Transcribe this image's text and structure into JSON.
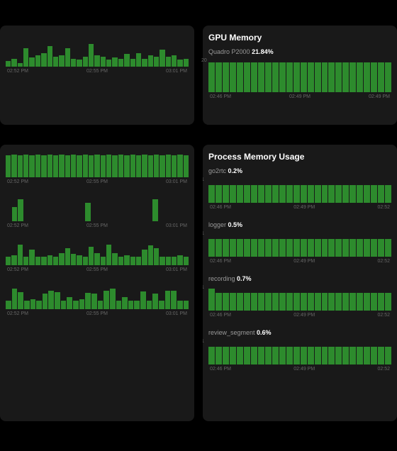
{
  "row1": {
    "left_panel": {
      "x_ticks": [
        "02:52 PM",
        "02:55 PM",
        "03:01 PM"
      ]
    },
    "gpu_memory": {
      "title": "GPU Memory",
      "device": "Quadro P2000",
      "value": "21.84%",
      "y_tick": "20",
      "x_ticks": [
        "02:46 PM",
        "02:49 PM",
        "02:49 PM"
      ]
    }
  },
  "row2": {
    "left_stack": {
      "x_ticks": [
        "02:52 PM",
        "02:55 PM",
        "03:01 PM"
      ]
    },
    "process_memory": {
      "title": "Process Memory Usage",
      "x_ticks": [
        "02:46 PM",
        "02:49 PM",
        "02:52"
      ],
      "y_tick": "1",
      "items": [
        {
          "name": "go2rtc",
          "value": "0.2%"
        },
        {
          "name": "logger",
          "value": "0.5%"
        },
        {
          "name": "recording",
          "value": "0.7%"
        },
        {
          "name": "review_segment",
          "value": "0.6%"
        }
      ]
    }
  },
  "chart_data": [
    {
      "type": "bar",
      "title": "",
      "xlabel": "",
      "ylabel": "",
      "x_ticks": [
        "02:52 PM",
        "02:55 PM",
        "03:01 PM"
      ],
      "values": [
        5,
        7,
        3,
        16,
        8,
        10,
        12,
        18,
        9,
        10,
        16,
        7,
        6,
        9,
        20,
        10,
        9,
        6,
        8,
        7,
        11,
        7,
        12,
        7,
        10,
        9,
        15,
        9,
        10,
        6,
        7
      ]
    },
    {
      "type": "bar",
      "title": "GPU Memory",
      "series_name": "Quadro P2000",
      "current": 21.84,
      "xlabel": "",
      "ylabel": "%",
      "ylim": [
        0,
        25
      ],
      "x_ticks": [
        "02:46 PM",
        "02:49 PM",
        "02:49 PM"
      ],
      "values": [
        22,
        22,
        22,
        22,
        22,
        22,
        22,
        22,
        22,
        22,
        22,
        22,
        22,
        22,
        22,
        22,
        22,
        22,
        22,
        22,
        22,
        22,
        22,
        22,
        22,
        22
      ]
    },
    {
      "type": "bar",
      "title": "left-stack-0",
      "x_ticks": [
        "02:52 PM",
        "02:55 PM",
        "03:01 PM"
      ],
      "values": [
        26,
        27,
        26,
        27,
        26,
        27,
        26,
        27,
        26,
        27,
        26,
        27,
        26,
        27,
        26,
        27,
        26,
        27,
        26,
        27,
        26,
        27,
        26,
        27,
        26,
        27,
        26,
        27,
        26,
        27,
        26
      ]
    },
    {
      "type": "bar",
      "title": "left-stack-1",
      "x_ticks": [
        "02:52 PM",
        "02:55 PM",
        "03:01 PM"
      ],
      "values": [
        0,
        17,
        26,
        0,
        0,
        0,
        0,
        0,
        0,
        0,
        0,
        0,
        0,
        22,
        0,
        0,
        0,
        0,
        0,
        0,
        0,
        0,
        0,
        0,
        26,
        0,
        0,
        0,
        0,
        0
      ]
    },
    {
      "type": "bar",
      "title": "left-stack-2",
      "x_ticks": [
        "02:52 PM",
        "02:55 PM",
        "03:01 PM"
      ],
      "values": [
        10,
        12,
        24,
        10,
        18,
        10,
        10,
        12,
        10,
        14,
        20,
        13,
        12,
        10,
        22,
        14,
        10,
        24,
        14,
        10,
        12,
        10,
        10,
        18,
        23,
        20,
        10,
        10,
        10,
        12,
        10
      ]
    },
    {
      "type": "bar",
      "title": "left-stack-3",
      "x_ticks": [
        "02:52 PM",
        "02:55 PM",
        "03:01 PM"
      ],
      "values": [
        10,
        24,
        20,
        10,
        12,
        10,
        18,
        22,
        20,
        10,
        14,
        10,
        12,
        19,
        18,
        10,
        22,
        24,
        10,
        14,
        10,
        10,
        21,
        10,
        18,
        10,
        22,
        22,
        10,
        10
      ]
    },
    {
      "type": "bar",
      "title": "Process Memory Usage",
      "xlabel": "",
      "ylabel": "%",
      "ylim": [
        0,
        1
      ],
      "x_ticks": [
        "02:46 PM",
        "02:49 PM",
        "02:52"
      ],
      "series": [
        {
          "name": "go2rtc",
          "current": 0.2,
          "values": [
            0.7,
            0.7,
            0.7,
            0.7,
            0.7,
            0.7,
            0.7,
            0.7,
            0.7,
            0.7,
            0.7,
            0.7,
            0.7,
            0.7,
            0.7,
            0.7,
            0.7,
            0.7,
            0.7,
            0.7,
            0.7,
            0.7,
            0.7,
            0.7,
            0.7,
            0.7
          ]
        },
        {
          "name": "logger",
          "current": 0.5,
          "values": [
            0.7,
            0.7,
            0.7,
            0.7,
            0.7,
            0.7,
            0.7,
            0.7,
            0.7,
            0.7,
            0.7,
            0.7,
            0.7,
            0.7,
            0.7,
            0.7,
            0.7,
            0.7,
            0.7,
            0.7,
            0.7,
            0.7,
            0.7,
            0.7,
            0.7,
            0.7
          ]
        },
        {
          "name": "recording",
          "current": 0.7,
          "values": [
            0.85,
            0.7,
            0.7,
            0.7,
            0.7,
            0.7,
            0.7,
            0.7,
            0.7,
            0.7,
            0.7,
            0.7,
            0.7,
            0.7,
            0.7,
            0.7,
            0.7,
            0.7,
            0.7,
            0.7,
            0.7,
            0.7,
            0.7,
            0.7,
            0.7,
            0.7
          ]
        },
        {
          "name": "review_segment",
          "current": 0.6,
          "values": [
            0.7,
            0.7,
            0.7,
            0.7,
            0.7,
            0.7,
            0.7,
            0.7,
            0.7,
            0.7,
            0.7,
            0.7,
            0.7,
            0.7,
            0.7,
            0.7,
            0.7,
            0.7,
            0.7,
            0.7,
            0.7,
            0.7,
            0.7,
            0.7,
            0.7,
            0.7
          ]
        }
      ]
    }
  ]
}
